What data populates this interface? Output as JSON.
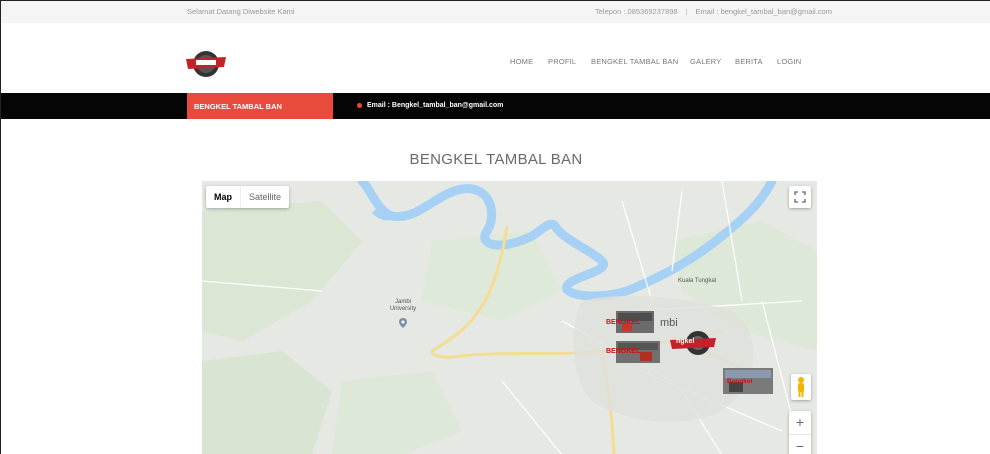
{
  "topbar": {
    "welcome": "Selamat Datang Diwebsite Kami",
    "phone": "Telepon : 085369237898",
    "email": "Email : bengkel_tambal_ban@gmail.com"
  },
  "nav": {
    "items": [
      "HOME",
      "PROFIL",
      "BENGKEL TAMBAL BAN",
      "GALERY",
      "BERITA",
      "LOGIN"
    ]
  },
  "infobar": {
    "tag": "BENGKEL TAMBAL BAN",
    "email": "Email : Bengkel_tambal_ban@gmail.com"
  },
  "page": {
    "title": "BENGKEL TAMBAL BAN"
  },
  "map": {
    "type_map": "Map",
    "type_satellite": "Satellite",
    "labels": {
      "kuala_tungkal": "Kuala Tungkal",
      "jambi_university": "Jambi University",
      "city": "mbi"
    },
    "marker_labels": [
      "BENGKEL",
      "BENGKEL",
      "ngkel",
      "Bengkel"
    ],
    "zoom_in": "+",
    "zoom_out": "−"
  },
  "colors": {
    "accent": "#e84a3c",
    "bar": "#050505",
    "river": "#a6d1f5",
    "road": "#f4dd92"
  }
}
